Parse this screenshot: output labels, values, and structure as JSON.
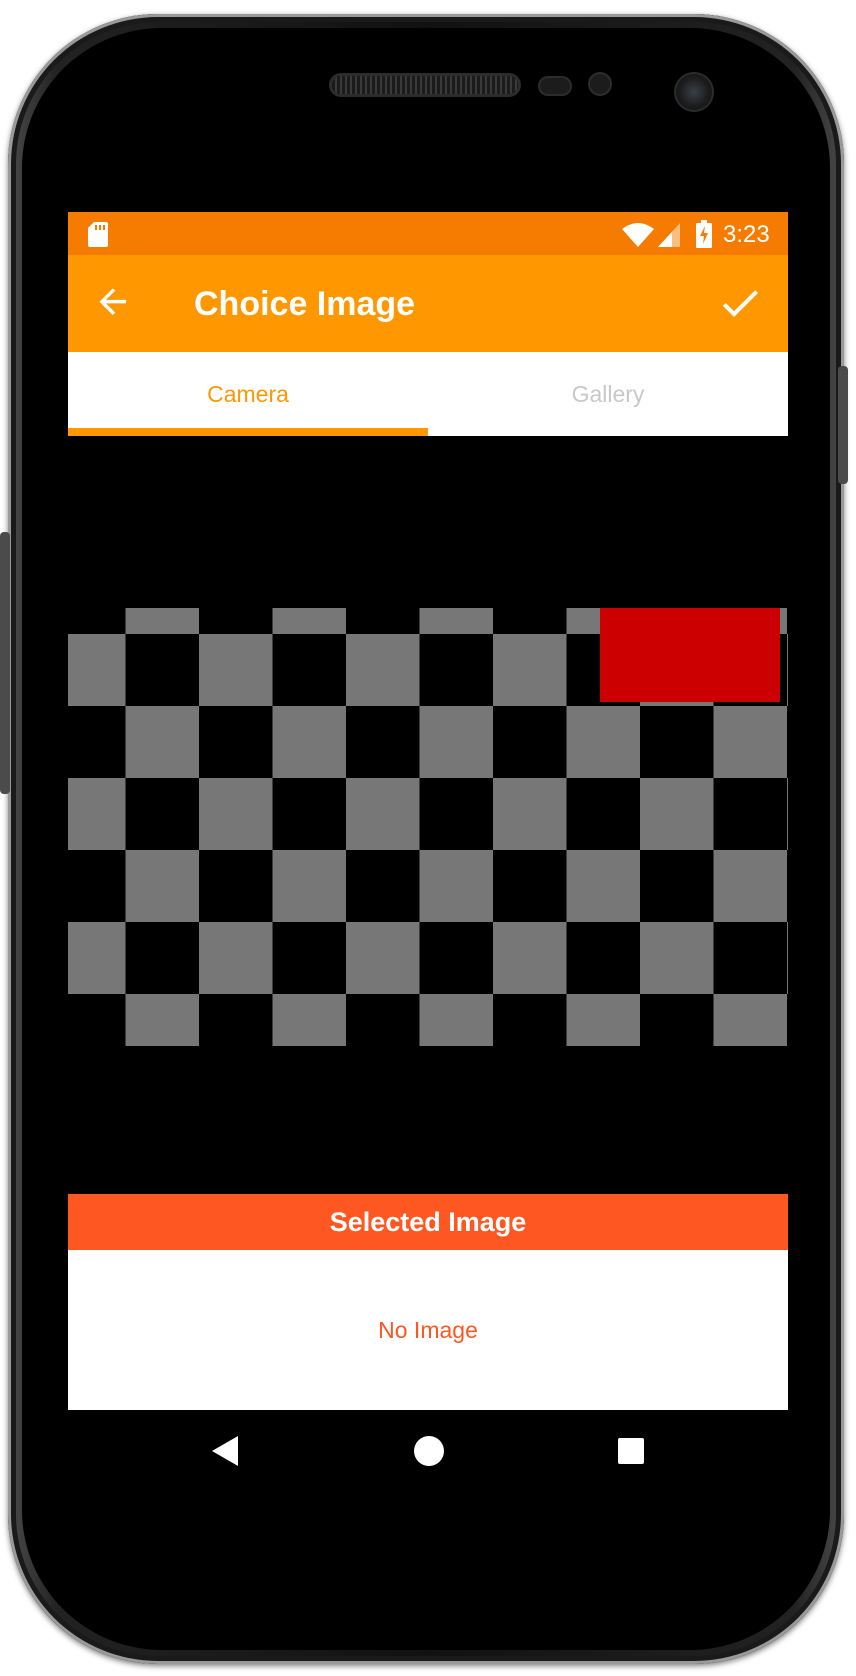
{
  "status_bar": {
    "time": "3:23"
  },
  "app_bar": {
    "title": "Choice Image"
  },
  "tabs": [
    {
      "label": "Camera",
      "selected": true
    },
    {
      "label": "Gallery",
      "selected": false
    }
  ],
  "selected_section": {
    "header": "Selected Image",
    "empty_text": "No Image"
  },
  "icons": {
    "back": "arrow-back-icon",
    "done": "check-icon",
    "capture": "camera-switch-icon"
  },
  "colors": {
    "status_bar": "#f57c00",
    "app_bar": "#ff9800",
    "tab_active": "#ff9800",
    "tab_inactive": "#c8c8c8",
    "selected_header": "#ff5722",
    "capture_button": "#3f5e9c"
  }
}
